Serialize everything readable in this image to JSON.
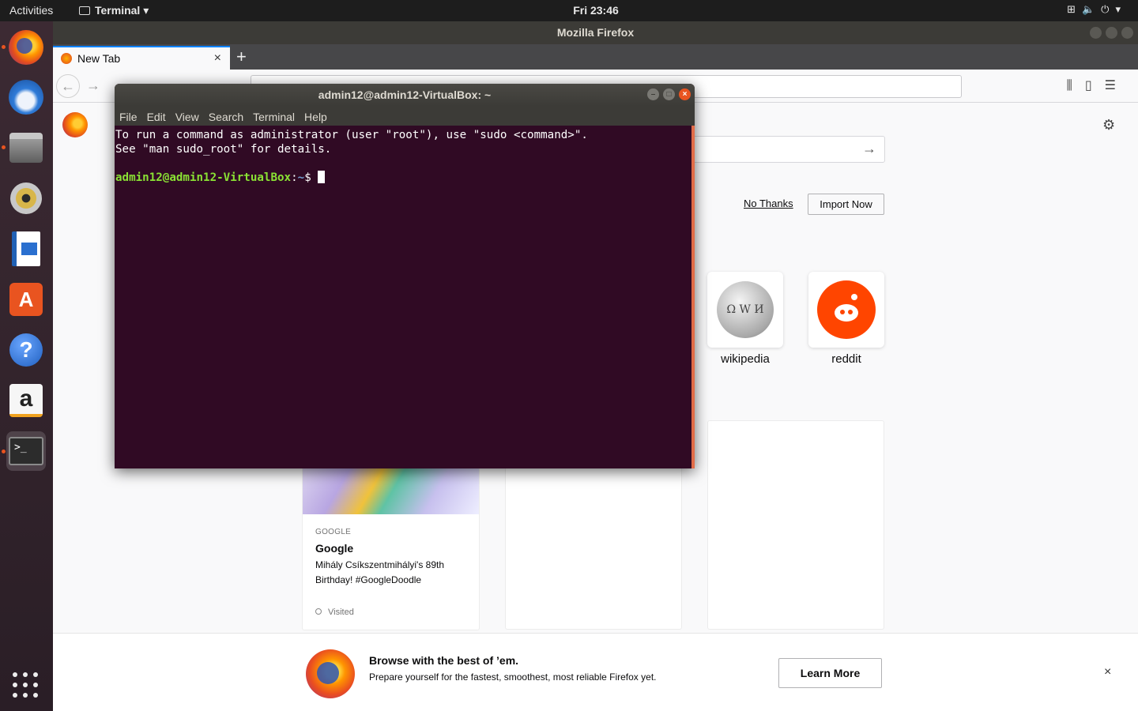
{
  "topbar": {
    "activities": "Activities",
    "app_name": "Terminal",
    "clock": "Fri 23:46",
    "tray_icons": [
      "network-icon",
      "volume-icon",
      "power-icon",
      "chevron-down-icon"
    ]
  },
  "dock": {
    "items": [
      "firefox",
      "thunderbird",
      "files",
      "rhythmbox",
      "libreoffice-writer",
      "ubuntu-software",
      "help",
      "amazon",
      "terminal"
    ],
    "store_letter": "A",
    "help_glyph": "?",
    "amazon_letter": "a",
    "terminal_glyph": ">_"
  },
  "firefox": {
    "window_title": "Mozilla Firefox",
    "tab_label": "New Tab",
    "new_tab_glyph": "+",
    "tab_close_glyph": "×",
    "no_thanks": "No Thanks",
    "import_now": "Import Now",
    "top_sites": [
      {
        "label": "wikipedia"
      },
      {
        "label": "reddit"
      }
    ],
    "wiki_glyph": "Ω W И",
    "story": {
      "source": "GOOGLE",
      "title": "Google",
      "description": "Mihály Csíkszentmihályi's 89th Birthday! #GoogleDoodle",
      "visited": "Visited"
    },
    "snippet": {
      "title": "Browse with the best of ’em.",
      "text": "Prepare yourself for the fastest, smoothest, most reliable Firefox yet.",
      "button": "Learn More",
      "close_glyph": "×"
    }
  },
  "terminal": {
    "title": "admin12@admin12-VirtualBox: ~",
    "menu": [
      "File",
      "Edit",
      "View",
      "Search",
      "Terminal",
      "Help"
    ],
    "line1": "To run a command as administrator (user \"root\"), use \"sudo <command>\".",
    "line2": "See \"man sudo_root\" for details.",
    "prompt_user": "admin12@admin12-VirtualBox",
    "prompt_path": "~",
    "prompt_sep": ":",
    "prompt_symbol": "$ "
  },
  "colors": {
    "terminal_bg": "#300a24",
    "accent": "#e95420",
    "prompt_green": "#8ae234",
    "prompt_blue": "#729fcf",
    "firefox_blue": "#0a84ff"
  }
}
